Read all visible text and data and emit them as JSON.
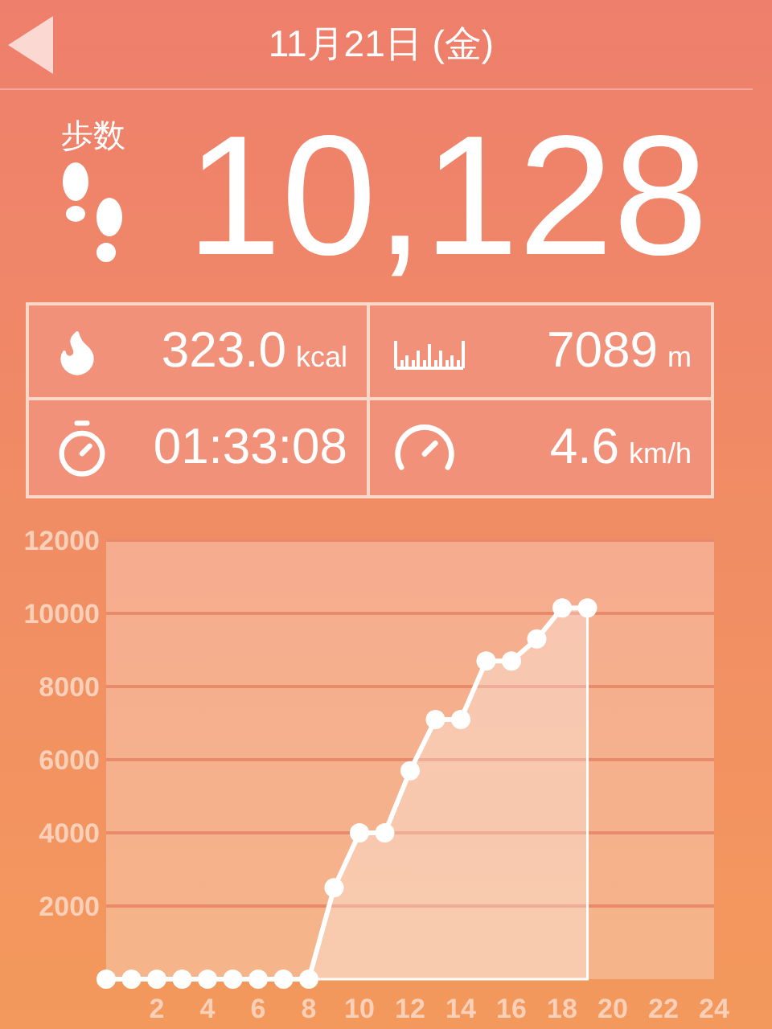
{
  "header": {
    "title": "11月21日 (金)"
  },
  "steps": {
    "label": "歩数",
    "value": "10,128"
  },
  "stats": [
    {
      "kind": "calories",
      "value": "323.0",
      "unit": "kcal"
    },
    {
      "kind": "distance",
      "value": "7089",
      "unit": "m"
    },
    {
      "kind": "duration",
      "value": "01:33:08"
    },
    {
      "kind": "speed",
      "value": "4.6",
      "unit": "km/h"
    }
  ],
  "chart": {
    "chart_data": {
      "type": "area",
      "x": [
        0,
        1,
        2,
        3,
        4,
        5,
        6,
        7,
        8,
        9,
        10,
        11,
        12,
        13,
        14,
        15,
        16,
        17,
        18,
        19
      ],
      "series": [
        {
          "color": "#ffffff",
          "values": [
            0,
            0,
            0,
            0,
            0,
            0,
            0,
            0,
            0,
            2500,
            4000,
            4000,
            5700,
            7100,
            7100,
            8700,
            8700,
            9300,
            10150,
            10150
          ]
        }
      ],
      "xlim": [
        0,
        24
      ],
      "ylim": [
        0,
        12000
      ],
      "xticks": [
        2,
        4,
        6,
        8,
        10,
        12,
        14,
        16,
        18,
        20,
        22,
        24
      ],
      "yticks": [
        2000,
        4000,
        6000,
        8000,
        10000,
        12000
      ],
      "grid": true
    }
  }
}
